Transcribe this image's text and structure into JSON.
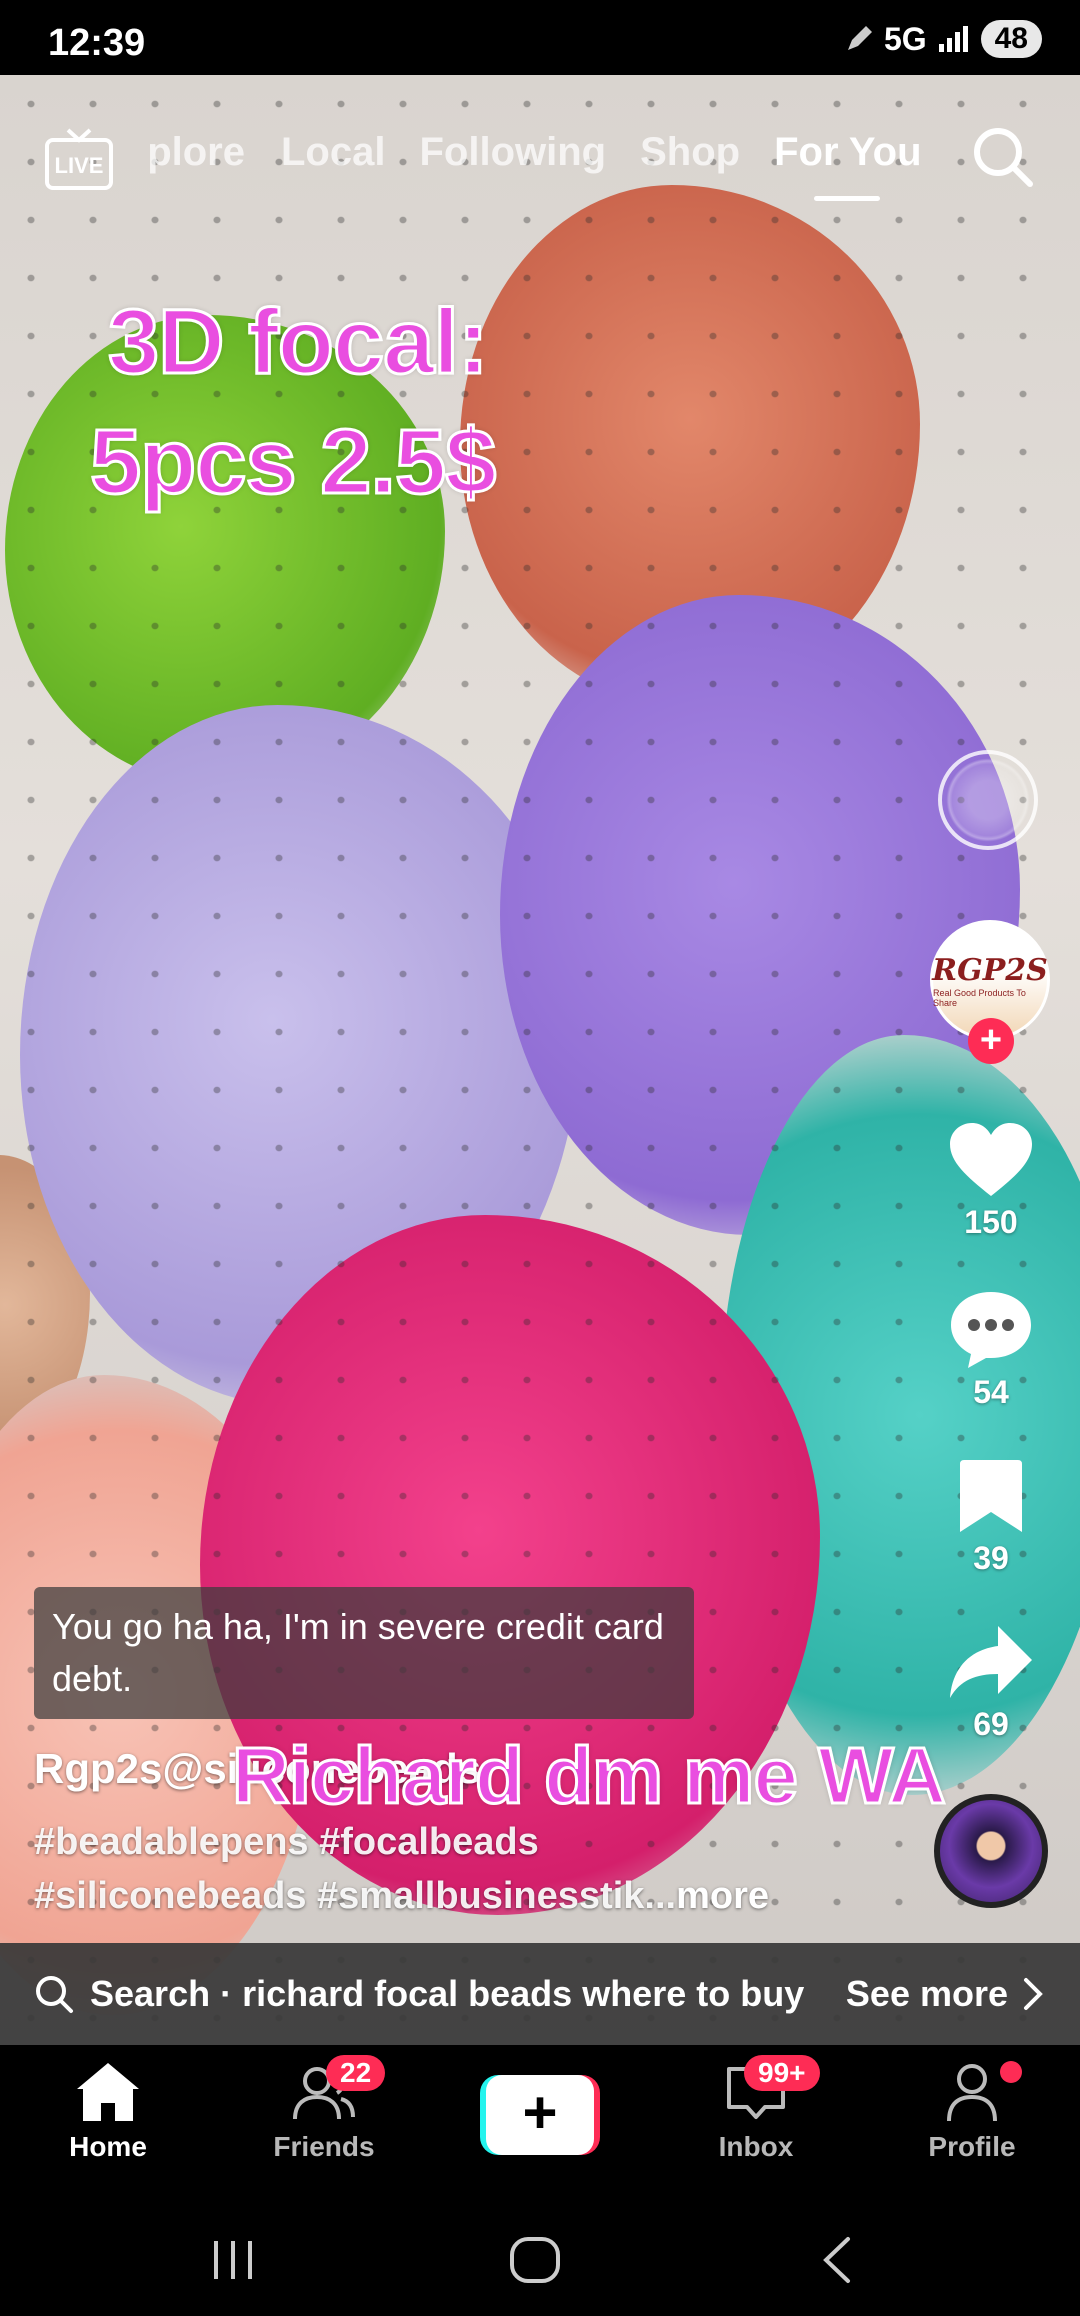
{
  "status_bar": {
    "time": "12:39",
    "network": "5G",
    "battery": "48"
  },
  "top_nav": {
    "live_label": "LIVE",
    "tabs": [
      {
        "label": "Explore",
        "visible_text": "plore"
      },
      {
        "label": "Local"
      },
      {
        "label": "Following"
      },
      {
        "label": "Shop"
      },
      {
        "label": "For You",
        "active": true
      }
    ]
  },
  "video_overlay": {
    "promo_line_1": "3D focal:",
    "promo_line_2": "5pcs 2.5$",
    "promo_line_3": "Richard dm me WA"
  },
  "creator": {
    "avatar_text": "RGP2S",
    "avatar_tagline": "Real Good Products To Share"
  },
  "actions": {
    "likes": "150",
    "comments": "54",
    "saves": "39",
    "shares": "69"
  },
  "caption": {
    "subtitle": "You go ha ha, I'm in severe credit card debt.",
    "username": "Rgp2s@siliconebeads",
    "hashtags_line_1": "#beadablepens #focalbeads",
    "hashtags_line_2": "#siliconebeads #smallbusinesstik...",
    "more_label": "more"
  },
  "search_suggestion": {
    "text": "Search · richard focal beads where to buy",
    "see_more": "See more"
  },
  "bottom_nav": {
    "home": "Home",
    "friends": "Friends",
    "friends_badge": "22",
    "inbox": "Inbox",
    "inbox_badge": "99+",
    "profile": "Profile"
  },
  "colors": {
    "accent": "#fe2c55",
    "accent_cyan": "#25f4ee",
    "overlay_text": "#e94ee0"
  }
}
